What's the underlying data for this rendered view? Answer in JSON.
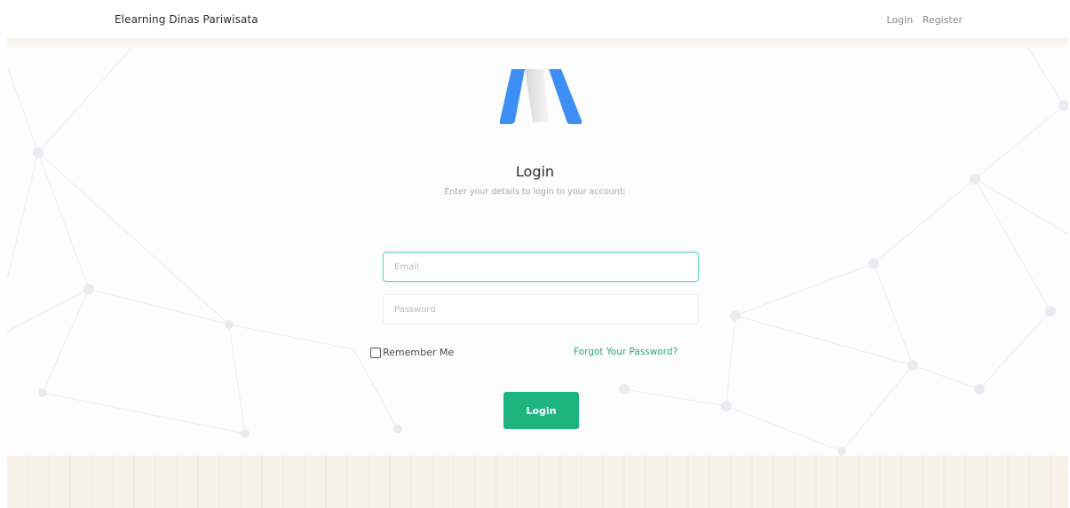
{
  "navbar": {
    "brand": "Elearning Dinas Pariwisata",
    "links": [
      "Login",
      "Register"
    ]
  },
  "logo": {
    "icon": "brand-logo-icon",
    "color": "#3d8ef5"
  },
  "login_form": {
    "title": "Login",
    "subtitle": "Enter your details to login to your account:",
    "email_placeholder": "Email",
    "password_placeholder": "Password",
    "remember_label": "Remember Me",
    "forgot_label": "Forgot Your Password?",
    "submit_label": "Login"
  },
  "colors": {
    "accent": "#1fb380",
    "link": "#2aa57f",
    "focus_border": "#6fd7cb",
    "logo_blue": "#3d8ef5"
  }
}
